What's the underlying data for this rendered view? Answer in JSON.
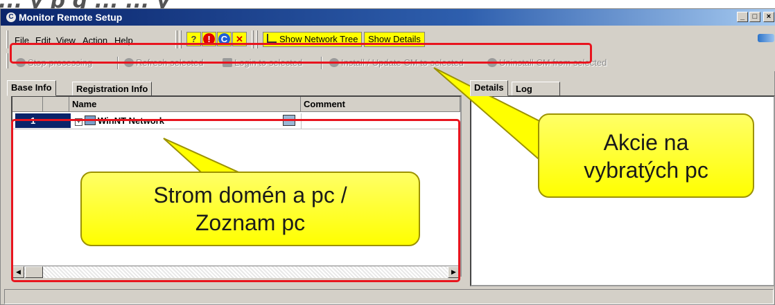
{
  "heading_fragment": "... y  p  g  ...  ...  y",
  "window": {
    "title": "Monitor Remote Setup",
    "title_icon": "C",
    "controls": [
      "_",
      "□",
      "×"
    ]
  },
  "menu": [
    "File",
    "Edit",
    "View",
    "Action",
    "Help"
  ],
  "toolbar": {
    "icons": [
      "help-icon",
      "alert-icon",
      "connect-icon",
      "remove-icon"
    ],
    "icon_glyphs": [
      "?",
      "!",
      "C",
      "✕"
    ],
    "show_network_tree": "Show Network Tree",
    "show_details": "Show Details"
  },
  "actions": {
    "stop": "Stop processing",
    "refresh": "Refresh selected",
    "login": "Login to selected",
    "install": "Install / Update CM to selected",
    "uninstall": "Uninstall CM from selected"
  },
  "left_tabs": [
    "Base Info",
    "Registration Info"
  ],
  "right_tabs": [
    "Details",
    "Log"
  ],
  "grid": {
    "columns": [
      "Name",
      "Comment"
    ],
    "rows": [
      {
        "num": "1",
        "name": "WinNT Network",
        "comment": ""
      }
    ]
  },
  "callouts": {
    "tree": "Strom domén a pc / Zoznam pc",
    "actions": "Akcie na vybratých pc"
  },
  "colors": {
    "highlight_red": "#e8141e",
    "callout_yellow": "#ffff00",
    "title_blue": "#0a246a",
    "selection_blue": "#0a246a"
  }
}
